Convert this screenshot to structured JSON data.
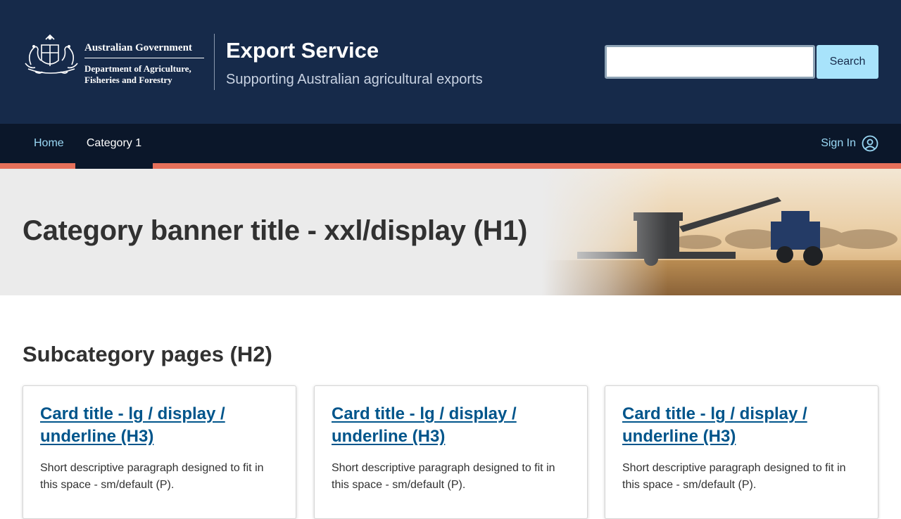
{
  "header": {
    "government_name": "Australian Government",
    "department_line1": "Department of Agriculture,",
    "department_line2": "Fisheries and Forestry",
    "service_title": "Export Service",
    "service_subtitle": "Supporting Australian agricultural exports",
    "search": {
      "value": "",
      "placeholder": "",
      "button_label": "Search"
    }
  },
  "nav": {
    "items": [
      {
        "label": "Home",
        "active": false
      },
      {
        "label": "Category 1",
        "active": true
      }
    ],
    "sign_in_label": "Sign In",
    "sign_in_icon": "user-circle-icon"
  },
  "banner": {
    "title": "Category banner title - xxl/display (H1)",
    "image": "combine-harvester-wheat-field"
  },
  "section": {
    "heading": "Subcategory pages (H2)",
    "cards": [
      {
        "title": "Card title - lg / display / underline (H3)",
        "text": "Short descriptive paragraph designed to fit in this space - sm/default (P)."
      },
      {
        "title": "Card title - lg / display / underline (H3)",
        "text": "Short descriptive paragraph designed to fit in this space - sm/default (P)."
      },
      {
        "title": "Card title - lg / display / underline (H3)",
        "text": "Short descriptive paragraph designed to fit in this space - sm/default (P)."
      }
    ]
  },
  "colors": {
    "header_bg": "#162a4a",
    "nav_bg": "#0b172a",
    "nav_accent": "#e6705a",
    "link": "#00558b",
    "search_button": "#a8e3fb"
  }
}
